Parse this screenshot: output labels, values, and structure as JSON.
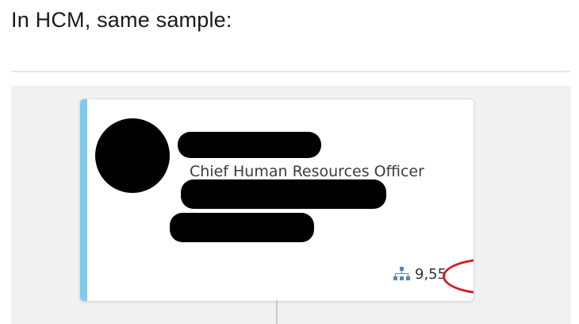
{
  "intro_text": "In HCM, same sample:",
  "org_card": {
    "job_title": "Chief Human Resources Officer",
    "reports_count": "9,55",
    "icon": "org-chart-icon",
    "accent_color": "#7fcbee",
    "highlight_color": "#d7191f"
  }
}
